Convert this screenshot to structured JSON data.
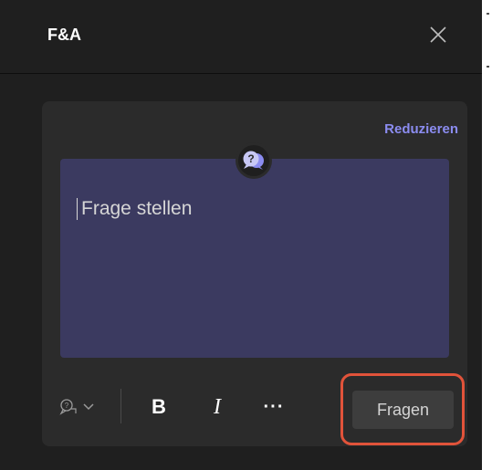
{
  "header": {
    "title": "F&A"
  },
  "card": {
    "collapse_label": "Reduzieren",
    "compose": {
      "placeholder": "Frage stellen",
      "value": ""
    },
    "toolbar": {
      "bold_label": "B",
      "italic_label": "I",
      "more_label": "···",
      "submit_label": "Fragen"
    }
  },
  "icons": {
    "close": "close-icon",
    "qa_badge": "qa-speech-bubble-icon",
    "type_picker": "question-type-icon",
    "dropdown": "chevron-down-icon"
  },
  "colors": {
    "panel_bg": "#1f1f1f",
    "card_bg": "#2b2b2b",
    "compose_bg": "#3b3a60",
    "accent": "#8b8cf0",
    "highlight": "#e1533a"
  }
}
